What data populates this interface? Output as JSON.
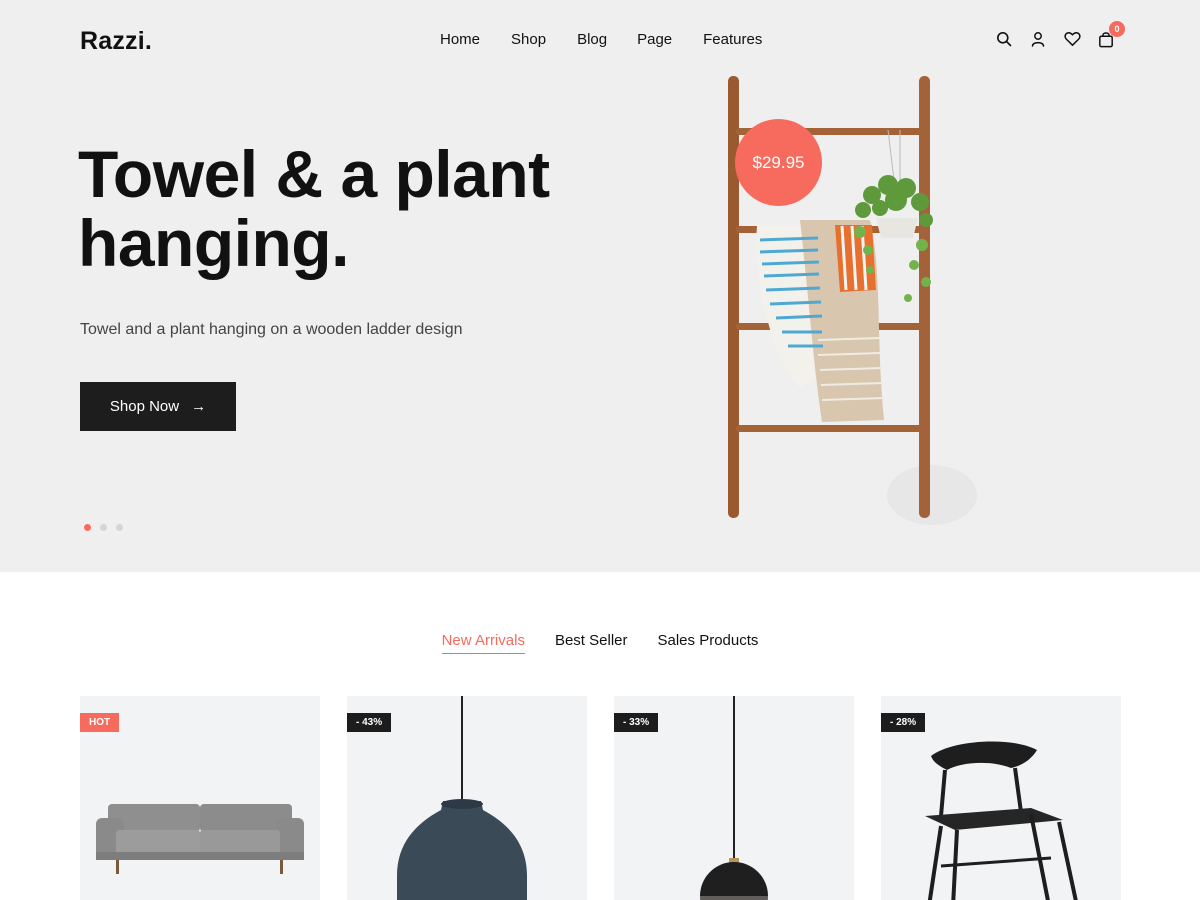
{
  "header": {
    "logo": "Razzi.",
    "nav": [
      "Home",
      "Shop",
      "Blog",
      "Page",
      "Features"
    ],
    "icons": [
      "search-icon",
      "user-icon",
      "heart-icon",
      "bag-icon"
    ],
    "cart_count": "0"
  },
  "hero": {
    "title": "Towel & a plant hanging.",
    "subtitle": "Towel and a plant hanging on a wooden ladder design",
    "button_label": "Shop Now",
    "price": "$29.95",
    "slides": 3,
    "active_slide": 1
  },
  "tabs": {
    "items": [
      "New Arrivals",
      "Best Seller",
      "Sales Products"
    ],
    "active": "New Arrivals"
  },
  "products": [
    {
      "badge": "HOT",
      "badge_type": "hot",
      "image": "sofa"
    },
    {
      "badge": "- 43%",
      "badge_type": "sale",
      "image": "pendant-lamp"
    },
    {
      "badge": "- 33%",
      "badge_type": "sale",
      "image": "globe-lamp"
    },
    {
      "badge": "- 28%",
      "badge_type": "sale",
      "image": "chair"
    }
  ],
  "colors": {
    "accent": "#f66b5d",
    "dark": "#1d1d1d",
    "hero_bg": "#efefef",
    "card_bg": "#f2f3f4"
  }
}
